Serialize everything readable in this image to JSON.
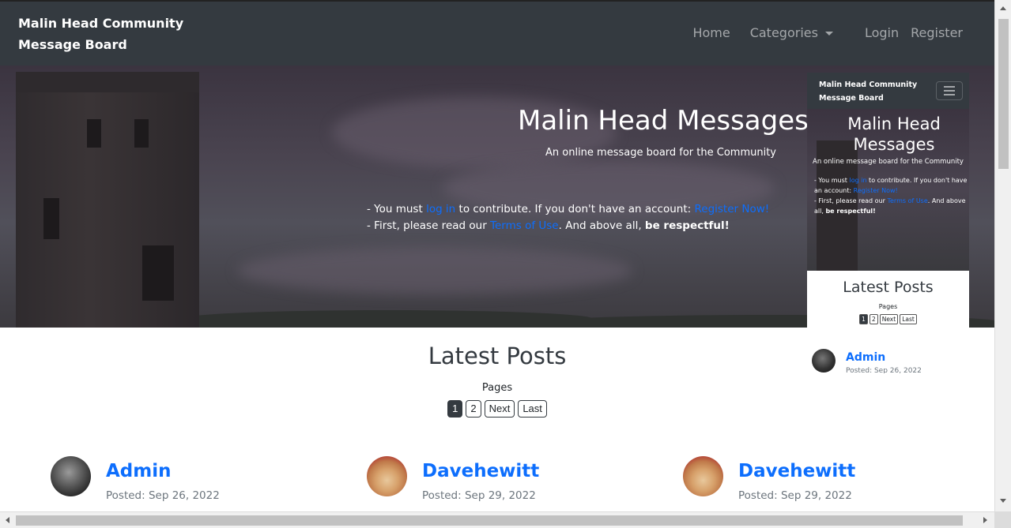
{
  "navbar": {
    "brand": "Malin Head Community Message Board",
    "home": "Home",
    "categories": "Categories",
    "login": "Login",
    "register": "Register"
  },
  "hero": {
    "title": "Malin Head Messages",
    "subtitle": "An online message board for the Community",
    "note1_prefix": "- You must ",
    "note1_link1": "log in",
    "note1_middle": " to contribute. If you don't have an account: ",
    "note1_link2": "Register Now!",
    "note2_prefix": "- First, please read our ",
    "note2_link": "Terms of Use",
    "note2_middle": ". And above all, ",
    "note2_bold": "be respectful!"
  },
  "mini_preview": {
    "brand": "Malin Head Community Message Board",
    "title": "Malin Head Messages",
    "subtitle": "An online message board for the Community",
    "note1_prefix": "- You must ",
    "note1_link1": "log in",
    "note1_middle": " to contribute. If you don't have an account: ",
    "note1_link2": "Register Now!",
    "note2_prefix": "- First, please read our ",
    "note2_link": "Terms of Use",
    "note2_middle": ". And above all, ",
    "note2_bold": "be respectful!",
    "latest_title": "Latest Posts",
    "pages_label": "Pages",
    "pager": [
      "1",
      "2",
      "Next",
      "Last"
    ],
    "post_name": "Admin",
    "post_date": "Posted: Sep 26, 2022"
  },
  "latest": {
    "title": "Latest Posts",
    "pages_label": "Pages",
    "pager": [
      "1",
      "2",
      "Next",
      "Last"
    ],
    "active_page": "1"
  },
  "posts": [
    {
      "name": "Admin",
      "date": "Posted: Sep 26, 2022",
      "avatar": "admin-avatar"
    },
    {
      "name": "Davehewitt",
      "date": "Posted: Sep 29, 2022",
      "avatar": "dog-avatar"
    },
    {
      "name": "Davehewitt",
      "date": "Posted: Sep 29, 2022",
      "avatar": "dog-avatar"
    }
  ],
  "colors": {
    "navbar_bg": "#343a40",
    "link": "#0d6efd"
  }
}
